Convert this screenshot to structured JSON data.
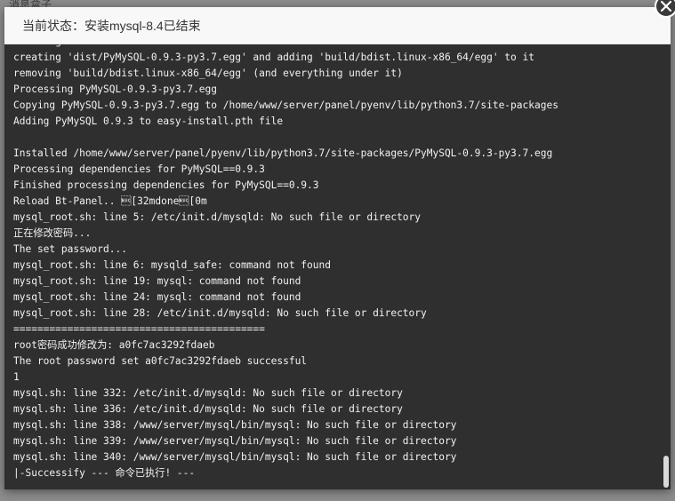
{
  "background": {
    "partial_text": "消息盒子"
  },
  "dialog": {
    "title": "当前状态：安装mysql-8.4已结束",
    "close_icon": "close-icon"
  },
  "console": {
    "lines": [
      "creating dist",
      "creating 'dist/PyMySQL-0.9.3-py3.7.egg' and adding 'build/bdist.linux-x86_64/egg' to it",
      "removing 'build/bdist.linux-x86_64/egg' (and everything under it)",
      "Processing PyMySQL-0.9.3-py3.7.egg",
      "Copying PyMySQL-0.9.3-py3.7.egg to /home/www/server/panel/pyenv/lib/python3.7/site-packages",
      "Adding PyMySQL 0.9.3 to easy-install.pth file",
      "",
      "Installed /home/www/server/panel/pyenv/lib/python3.7/site-packages/PyMySQL-0.9.3-py3.7.egg",
      "Processing dependencies for PyMySQL==0.9.3",
      "Finished processing dependencies for PyMySQL==0.9.3",
      "Reload Bt-Panel.. \u001b[32mdone\u001b[0m",
      "mysql_root.sh: line 5: /etc/init.d/mysqld: No such file or directory",
      "正在修改密码...",
      "The set password...",
      "mysql_root.sh: line 6: mysqld_safe: command not found",
      "mysql_root.sh: line 19: mysql: command not found",
      "mysql_root.sh: line 24: mysql: command not found",
      "mysql_root.sh: line 28: /etc/init.d/mysqld: No such file or directory",
      "==========================================",
      "root密码成功修改为: a0fc7ac3292fdaeb",
      "The root password set a0fc7ac3292fdaeb successful",
      "1",
      "mysql.sh: line 332: /etc/init.d/mysqld: No such file or directory",
      "mysql.sh: line 336: /etc/init.d/mysqld: No such file or directory",
      "mysql.sh: line 338: /www/server/mysql/bin/mysql: No such file or directory",
      "mysql.sh: line 339: /www/server/mysql/bin/mysql: No such file or directory",
      "mysql.sh: line 340: /www/server/mysql/bin/mysql: No such file or directory",
      "|-Successify --- 命令已执行! ---"
    ]
  },
  "colors": {
    "console_bg": "#2f2f2f",
    "console_text": "#f2f2f2",
    "title_bg": "#f8f8f8"
  }
}
